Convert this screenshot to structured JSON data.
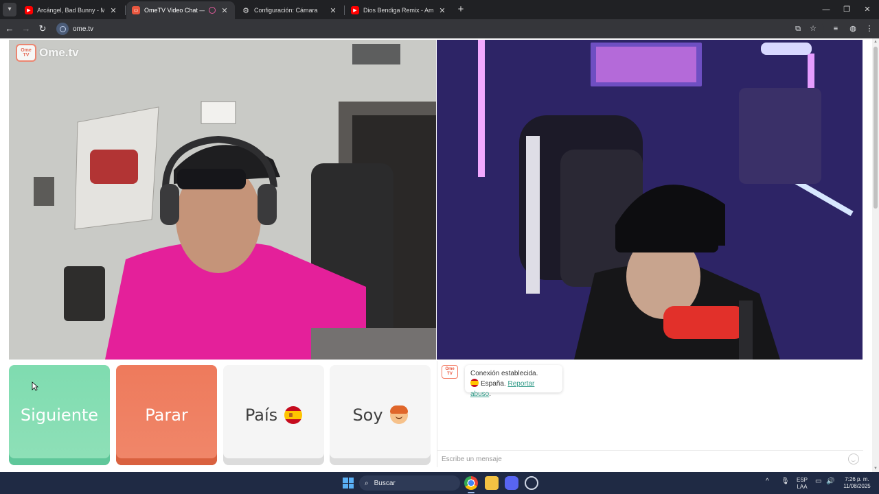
{
  "browser": {
    "tabs": [
      {
        "title": "Arcángel, Bad Bunny - Me Acos",
        "icon": "youtube-icon",
        "active": false
      },
      {
        "title": "OmeTV Video Chat — Ome",
        "icon": "ometv-icon",
        "active": true
      },
      {
        "title": "Configuración: Cámara",
        "icon": "settings-gear-icon",
        "active": false
      },
      {
        "title": "Dios Bendiga Remix - Amenaz",
        "icon": "youtube-icon",
        "active": false
      }
    ],
    "url": "ome.tv"
  },
  "app": {
    "logo_text": "Ome.tv",
    "logo_badge": "Ome TV",
    "colors": {
      "next": "#7fdcb0",
      "stop": "#ee7a5c",
      "link": "#2f9a87"
    }
  },
  "controls": {
    "next_label": "Siguiente",
    "stop_label": "Parar",
    "country_label": "País",
    "gender_label": "Soy"
  },
  "chat": {
    "system_message": "Conexión establecida.",
    "country": "España.",
    "report_link": "Reportar abuso",
    "report_suffix": ".",
    "input_placeholder": "Escribe un mensaje"
  },
  "taskbar": {
    "search_label": "Buscar",
    "lang_top": "ESP",
    "lang_bottom": "LAA",
    "time": "7:26 p. m.",
    "date": "11/08/2025"
  }
}
